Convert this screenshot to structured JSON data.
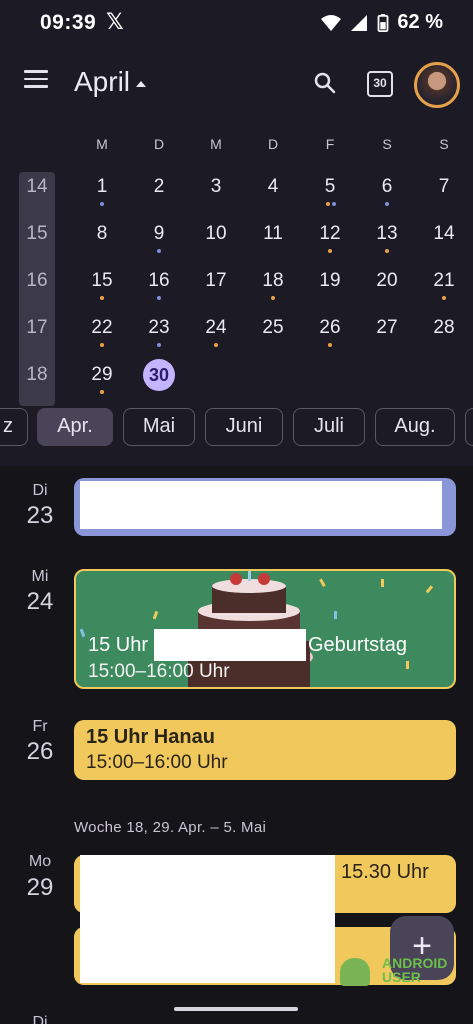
{
  "status": {
    "time": "09:39",
    "social_icon": "x-logo-icon",
    "battery": "62 %"
  },
  "header": {
    "title": "April",
    "today_number": "30"
  },
  "calendar": {
    "weekday_headers": [
      "M",
      "D",
      "M",
      "D",
      "F",
      "S",
      "S"
    ],
    "week_numbers": [
      "14",
      "15",
      "16",
      "17",
      "18"
    ],
    "rows": [
      [
        "1",
        "2",
        "3",
        "4",
        "5",
        "6",
        "7"
      ],
      [
        "8",
        "9",
        "10",
        "11",
        "12",
        "13",
        "14"
      ],
      [
        "15",
        "16",
        "17",
        "18",
        "19",
        "20",
        "21"
      ],
      [
        "22",
        "23",
        "24",
        "25",
        "26",
        "27",
        "28"
      ],
      [
        "29",
        "30",
        "",
        "",
        "",
        "",
        ""
      ]
    ],
    "today": "30"
  },
  "month_chips": [
    "z",
    "Apr.",
    "Mai",
    "Juni",
    "Juli",
    "Aug."
  ],
  "agenda": {
    "day_23": {
      "name": "Di",
      "num": "23"
    },
    "day_24": {
      "name": "Mi",
      "num": "24",
      "event_title_prefix": "15 Uhr",
      "event_title_suffix": "Geburtstag",
      "event_time": "15:00–16:00 Uhr"
    },
    "day_26": {
      "name": "Fr",
      "num": "26",
      "event_title": "15 Uhr Hanau",
      "event_time": "15:00–16:00 Uhr"
    },
    "week_separator": "Woche 18, 29. Apr. – 5. Mai",
    "day_29": {
      "name": "Mo",
      "num": "29",
      "event_title": "15.30 Uhr"
    },
    "next_day_partial": "Di"
  },
  "fab_label": "+",
  "watermark": [
    "ANDROID",
    "USER"
  ],
  "colors": {
    "background": "#1b1a25",
    "today_accent": "#c3b5ff",
    "event_green": "#3c8a5e",
    "event_yellow": "#f0c85c",
    "event_lavender": "#8a96d8",
    "dot_orange": "#e8a24a",
    "dot_blue": "#7f8fd9"
  }
}
